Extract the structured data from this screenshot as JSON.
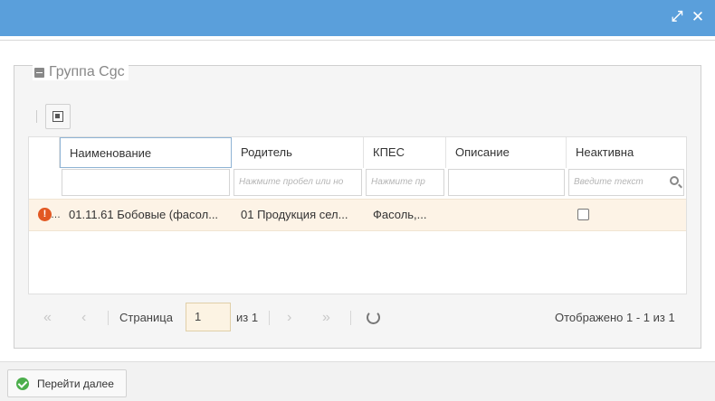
{
  "window": {
    "maximize_glyph": "⤢",
    "close_glyph": "✕"
  },
  "group": {
    "title": "Группа Cgc"
  },
  "grid": {
    "columns": [
      {
        "label": "Наименование",
        "filter_placeholder": ""
      },
      {
        "label": "Родитель",
        "filter_placeholder": "Нажмите пробел или но"
      },
      {
        "label": "КПЕС",
        "filter_placeholder": "Нажмите пр"
      },
      {
        "label": "Описание",
        "filter_placeholder": ""
      },
      {
        "label": "Неактивна",
        "filter_placeholder": "Введите текст"
      }
    ],
    "rows": [
      {
        "status_icon": "warning-icon",
        "status_mark": "!",
        "row_marker": "…",
        "name": "01.11.61 Бобовые (фасол...",
        "parent": "01 Продукция сел...",
        "kpes": "Фасоль,...",
        "description": "",
        "inactive": false
      }
    ]
  },
  "pager": {
    "first_glyph": "«",
    "prev_glyph": "‹",
    "page_label": "Страница",
    "page_value": "1",
    "of_label": "из 1",
    "next_glyph": "›",
    "last_glyph": "»",
    "summary": "Отображено 1 - 1 из 1"
  },
  "footer": {
    "next_button": "Перейти далее"
  },
  "colors": {
    "titlebar": "#5a9fdb",
    "row_highlight": "#fdf3e6",
    "warning": "#e25822",
    "ok": "#4cae4c"
  }
}
